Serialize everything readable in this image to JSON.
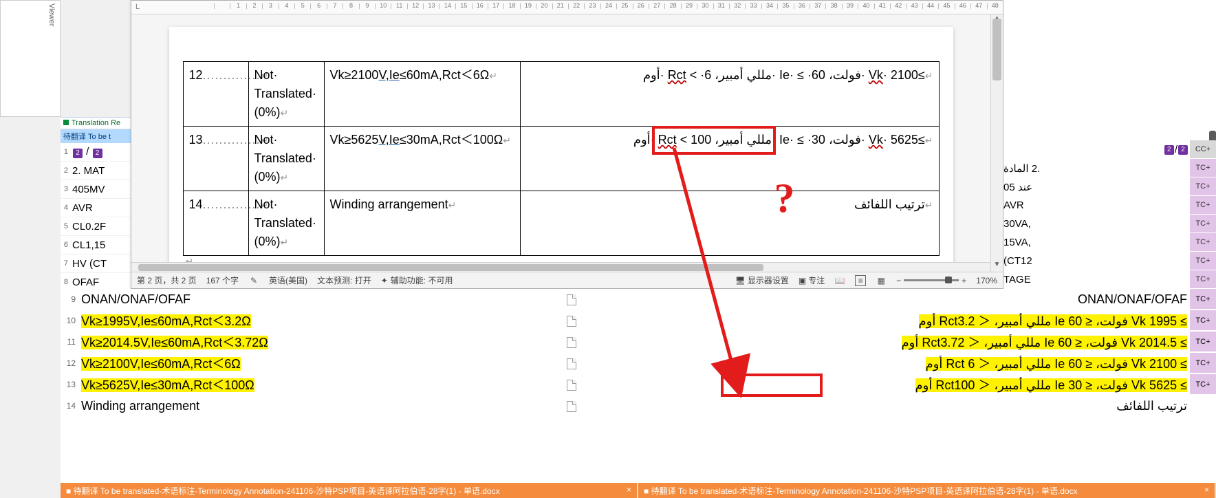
{
  "viewer_label": "Viewer",
  "left": {
    "header1": "Translation Re",
    "header2": "待翻译 To be t",
    "rows": [
      {
        "n": "1",
        "content_html": "badge2 / badge2"
      },
      {
        "n": "2",
        "content": "2. MAT"
      },
      {
        "n": "3",
        "content": "405MV"
      },
      {
        "n": "4",
        "content": "AVR"
      },
      {
        "n": "5",
        "content": "CL0.2F"
      },
      {
        "n": "6",
        "content": "CL1,15"
      },
      {
        "n": "7",
        "content": "HV (CT"
      },
      {
        "n": "8",
        "content": "OFAF"
      }
    ]
  },
  "word": {
    "rows": [
      {
        "n": "12",
        "status": "Not Translated (0%)",
        "src": "Vk≥2100V,Ie≤60mA,Rct＜6Ω",
        "tgt": "≥Vk· 2100 ·فولت، Ie· ≤ ·60 ·مللي أمبير، Rct < ·6 ·أوم"
      },
      {
        "n": "13",
        "status": "Not Translated (0%)",
        "src": "Vk≥5625V,Ie≤30mA,Rct＜100Ω",
        "tgt": "≥Vk· 5625 ·فولت، Ie· ≤ ·30 ·مللي أمبير، Rct < 100 ·أوم"
      },
      {
        "n": "14",
        "status": "Not Translated (0%)",
        "src": "Winding arrangement",
        "tgt": "ترتيب اللفائف"
      }
    ],
    "statusbar": {
      "page": "第 2 页，共 2 页",
      "words": "167 个字",
      "lang": "英语(美国)",
      "pred": "文本预测: 打开",
      "acc": "辅助功能: 不可用",
      "disp": "显示器设置",
      "focus": "专注",
      "zoom": "170%"
    }
  },
  "right": {
    "rows": [
      {
        "content_html": "badge2 / badge2",
        "tag": "CC+"
      },
      {
        "content": ".2 المادة",
        "tag": "TC+"
      },
      {
        "content": "عند 05",
        "tag": "TC+"
      },
      {
        "content": "AVR",
        "tag": "TC+"
      },
      {
        "content": ",30VA",
        "tag": "TC+"
      },
      {
        "content": ",15VA",
        "tag": "TC+"
      },
      {
        "content": "CT12)",
        "tag": "TC+"
      },
      {
        "content": "TAGE",
        "tag": "TC+"
      }
    ]
  },
  "grid": {
    "rows": [
      {
        "n": "9",
        "src": "ONAN/ONAF/OFAF",
        "tgt": "ONAN/ONAF/OFAF",
        "hl": false,
        "tag": "TC+"
      },
      {
        "n": "10",
        "src": "Vk≥1995V,Ie≤60mA,Rct＜3.2Ω",
        "tgt": "≥ Vk 1995 فولت، ≤ Ie 60 مللي أمبير، ＜ Rct3.2 أوم",
        "hl": true,
        "tag": "TC+"
      },
      {
        "n": "11",
        "src": "Vk≥2014.5V,Ie≤60mA,Rct＜3.72Ω",
        "tgt": "≥ Vk 2014.5 فولت، ≤ Ie 60 مللي أمبير، ＜ Rct3.72 أوم",
        "hl": true,
        "tag": "TC+"
      },
      {
        "n": "12",
        "src": "Vk≥2100V,Ie≤60mA,Rct＜6Ω",
        "tgt": "≥ Vk 2100 فولت، ≤ Ie 60 مللي أمبير، ＜ Rct 6 أوم",
        "hl": true,
        "tag": "TC+"
      },
      {
        "n": "13",
        "src": "Vk≥5625V,Ie≤30mA,Rct＜100Ω",
        "tgt": "≥ Vk 5625 فولت، ≤ Ie 30 مللي أمبير، ＜ Rct100 أوم",
        "hl": true,
        "tag": "TC+"
      },
      {
        "n": "14",
        "src": "Winding arrangement",
        "tgt": "ترتيب اللفائف",
        "hl": false,
        "tag": ""
      }
    ]
  },
  "filetabs": {
    "left": "待翻译 To be translated-术语标注-Terminology Annotation-241106-沙特PSP项目-英语译阿拉伯语-28字(1) - 单语.docx",
    "right": "待翻译 To be translated-术语标注-Terminology Annotation-241106-沙特PSP项目-英语译阿拉伯语-28字(1) - 单语.docx"
  },
  "ruler_ticks": [
    "",
    "1",
    "2",
    "3",
    "4",
    "5",
    "6",
    "7",
    "8",
    "9",
    "10",
    "11",
    "12",
    "13",
    "14",
    "15",
    "16",
    "17",
    "18",
    "19",
    "20",
    "21",
    "22",
    "23",
    "24",
    "25",
    "26",
    "27",
    "28",
    "29",
    "30",
    "31",
    "32",
    "33",
    "34",
    "35",
    "36",
    "37",
    "38",
    "39",
    "40",
    "41",
    "42",
    "43",
    "44",
    "45",
    "46",
    "47",
    "48"
  ]
}
